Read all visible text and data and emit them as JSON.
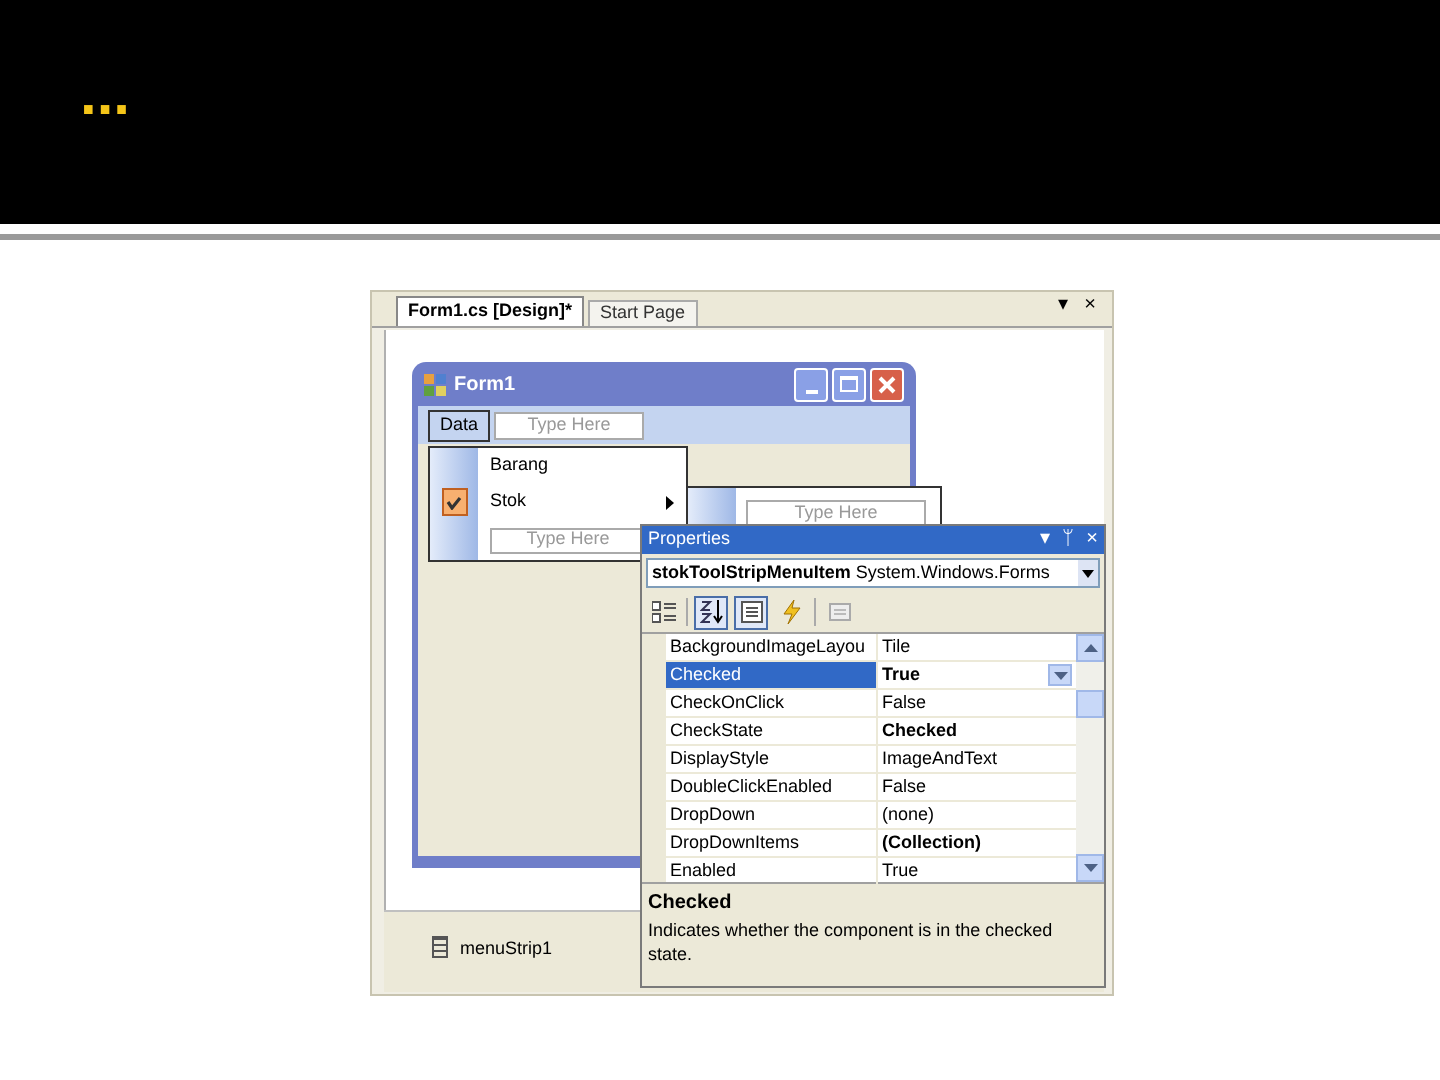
{
  "slide": {
    "title": "..."
  },
  "document_tabs": [
    {
      "label": "Form1.cs [Design]*",
      "selected": true
    },
    {
      "label": "Start Page",
      "selected": false
    }
  ],
  "tab_strip_buttons": [
    "▾",
    "×"
  ],
  "form": {
    "title": "Form1",
    "menu": [
      {
        "label": "Data",
        "selected": true
      }
    ],
    "menu_placeholder": "Type Here",
    "dropdown": [
      {
        "label": "Barang",
        "checked": false,
        "submenu": false
      },
      {
        "label": "Stok",
        "checked": true,
        "submenu": true
      }
    ],
    "dropdown_placeholder": "Type Here",
    "submenu_placeholder": "Type Here"
  },
  "component_tray": [
    {
      "label": "menuStrip1"
    }
  ],
  "properties": {
    "title": "Properties",
    "title_buttons": [
      "▾",
      "ᛘ",
      "×"
    ],
    "object": "**stokToolStripMenuItem** System.Windows.Forms",
    "toolbar": [
      {
        "kind": "categorized",
        "selected": false
      },
      {
        "kind": "alphabetical",
        "selected": true
      },
      {
        "kind": "properties",
        "selected": true
      },
      {
        "kind": "events",
        "selected": false
      },
      {
        "kind": "pages",
        "selected": false
      }
    ],
    "rows": [
      {
        "name": "BackgroundImageLayou",
        "value": "Tile",
        "bold": false,
        "selected": false
      },
      {
        "name": "Checked",
        "value": "True",
        "bold": true,
        "selected": true
      },
      {
        "name": "CheckOnClick",
        "value": "False",
        "bold": false,
        "selected": false
      },
      {
        "name": "CheckState",
        "value": "Checked",
        "bold": true,
        "selected": false
      },
      {
        "name": "DisplayStyle",
        "value": "ImageAndText",
        "bold": false,
        "selected": false
      },
      {
        "name": "DoubleClickEnabled",
        "value": "False",
        "bold": false,
        "selected": false
      },
      {
        "name": "DropDown",
        "value": "(none)",
        "bold": false,
        "selected": false
      },
      {
        "name": "DropDownItems",
        "value": "(Collection)",
        "bold": true,
        "selected": false
      },
      {
        "name": "Enabled",
        "value": "True",
        "bold": false,
        "selected": false
      }
    ],
    "description": {
      "title": "Checked",
      "text": "Indicates whether the component is in the checked state."
    }
  }
}
